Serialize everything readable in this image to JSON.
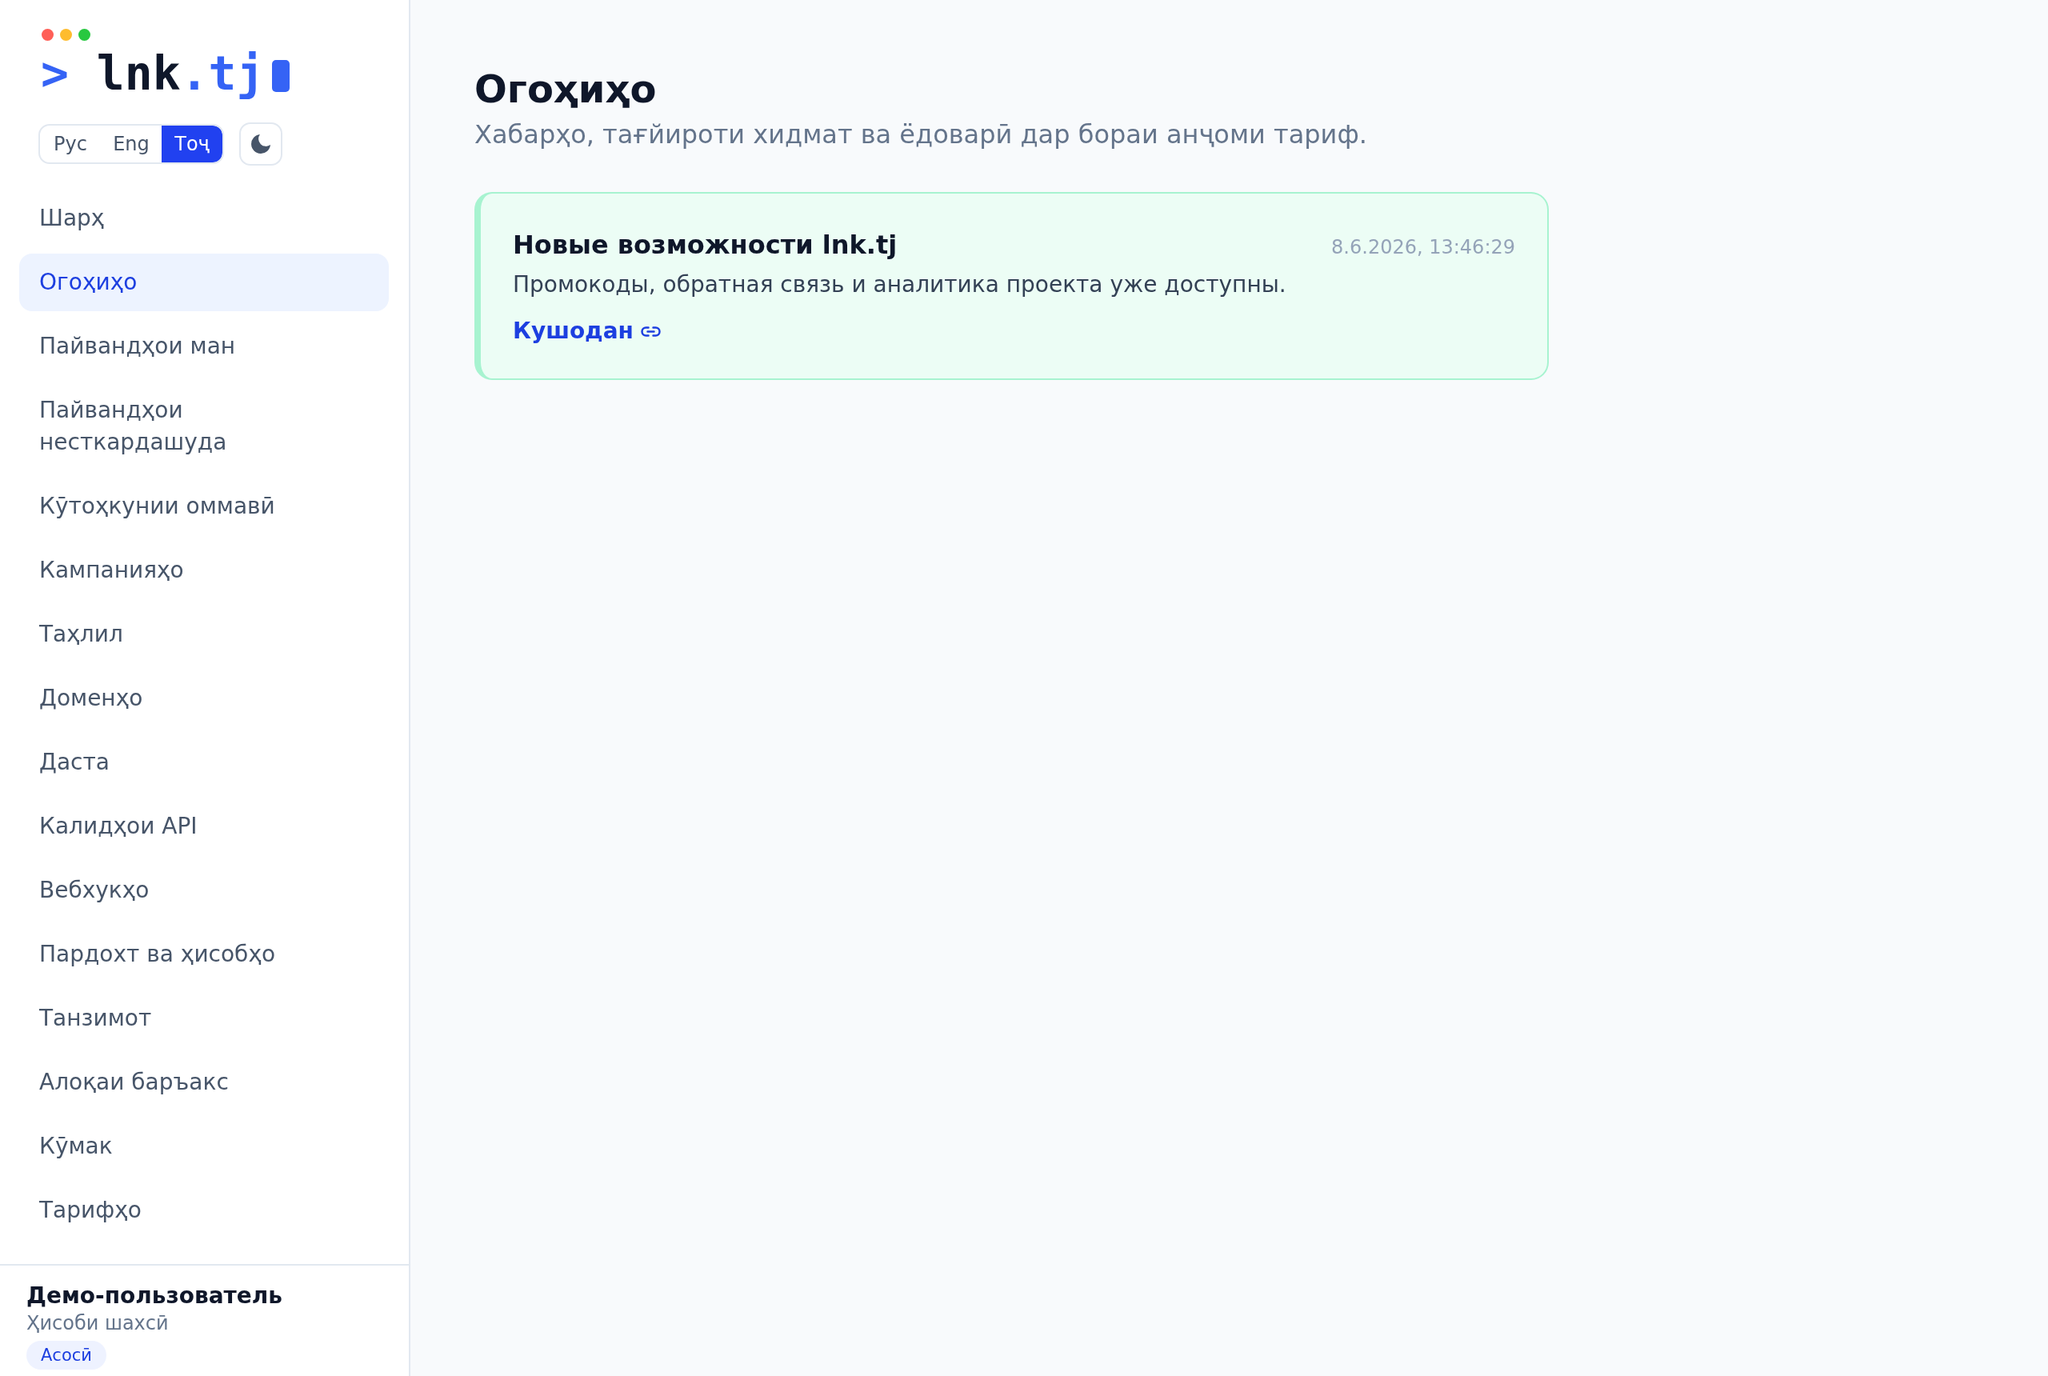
{
  "logo": {
    "prompt": ">",
    "name": "lnk",
    "domain": ".tj"
  },
  "languages": [
    {
      "label": "Рус",
      "selected": false
    },
    {
      "label": "Eng",
      "selected": false
    },
    {
      "label": "Тоҷ",
      "selected": true
    }
  ],
  "nav": [
    {
      "label": "Шарҳ",
      "selected": false
    },
    {
      "label": "Огоҳиҳо",
      "selected": true
    },
    {
      "label": "Пайвандҳои ман",
      "selected": false
    },
    {
      "label": "Пайвандҳои несткардашуда",
      "selected": false
    },
    {
      "label": "Кӯтоҳкунии оммавӣ",
      "selected": false
    },
    {
      "label": "Кампанияҳо",
      "selected": false
    },
    {
      "label": "Таҳлил",
      "selected": false
    },
    {
      "label": "Доменҳо",
      "selected": false
    },
    {
      "label": "Даста",
      "selected": false
    },
    {
      "label": "Калидҳои API",
      "selected": false
    },
    {
      "label": "Вебхукҳо",
      "selected": false
    },
    {
      "label": "Пардохт ва ҳисобҳо",
      "selected": false
    },
    {
      "label": "Танзимот",
      "selected": false
    },
    {
      "label": "Алоқаи баръакс",
      "selected": false
    },
    {
      "label": "Кӯмак",
      "selected": false
    },
    {
      "label": "Тарифҳо",
      "selected": false
    }
  ],
  "user": {
    "name": "Демо-пользователь",
    "account": "Ҳисоби шахсӣ",
    "plan": "Асосӣ"
  },
  "page": {
    "title": "Огоҳиҳо",
    "subtitle": "Хабарҳо, тағйироти хидмат ва ёдоварӣ дар бораи анҷоми тариф."
  },
  "notifications": [
    {
      "title": "Новые возможности lnk.tj",
      "time": "8.6.2026, 13:46:29",
      "text": "Промокоды, обратная связь и аналитика проекта уже доступны.",
      "link": "Кушодан"
    }
  ]
}
